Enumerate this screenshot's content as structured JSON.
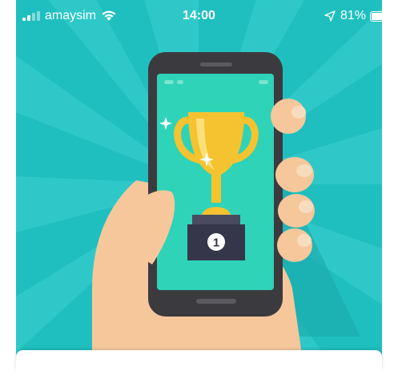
{
  "status_bar": {
    "carrier": "amaysim",
    "time": "14:00",
    "battery_percent": "81%",
    "signal_bars": 2,
    "battery_level": 0.81,
    "icons": [
      "signal-icon",
      "wifi-icon",
      "location-arrow-icon",
      "battery-icon"
    ]
  },
  "illustration": {
    "subject": "hand-holding-phone-with-trophy",
    "podium_badge": "1",
    "colors": {
      "background": "#1fbfbf",
      "rays": "#3dd0d0",
      "phone_body": "#3b3b3f",
      "phone_screen": "#2fd3b8",
      "trophy": "#f5c330",
      "podium": "#36364a",
      "hand": "#f6c79b"
    }
  }
}
